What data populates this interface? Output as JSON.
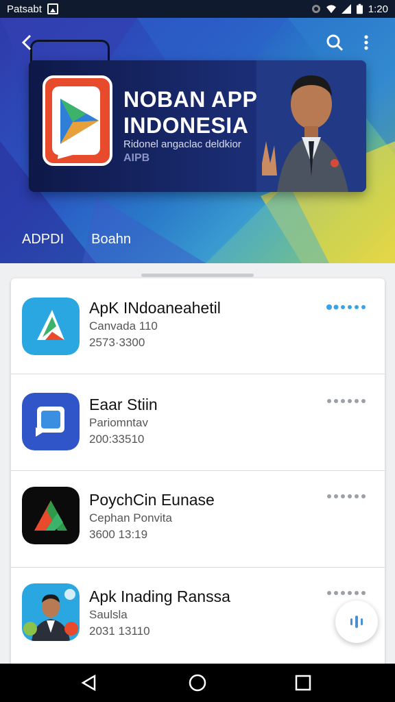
{
  "status_bar": {
    "carrier": "Patsabt",
    "time": "1:20"
  },
  "hero": {
    "banner": {
      "title_line1": "NOBAN APP",
      "title_line2": "INDONESIA",
      "subtitle": "Ridonel angaclac deldkior",
      "tag": "AIPB"
    },
    "tabs": [
      {
        "label": "ADPDI"
      },
      {
        "label": "Boahn"
      }
    ]
  },
  "apps": [
    {
      "name": "ApK INdoaneahetil",
      "subtitle": "Canvada 110",
      "meta": "2573·3300",
      "icon": "triangle-play-icon"
    },
    {
      "name": "Eaar Stiin",
      "subtitle": "Pariomntav",
      "meta": "200:33510",
      "icon": "chat-square-icon"
    },
    {
      "name": "PoychCin Eunase",
      "subtitle": "Cephan Ponvita",
      "meta": "3600 13:19",
      "icon": "a-triangle-icon"
    },
    {
      "name": "Apk Inading Ranssa",
      "subtitle": "Saulsla",
      "meta": "2031 13110",
      "icon": "person-photo-icon"
    }
  ],
  "colors": {
    "status_bar": "#0f1a2e",
    "banner": "#0e1848",
    "accent_dots": "#3aa3e6",
    "list_bg": "#ffffff"
  }
}
